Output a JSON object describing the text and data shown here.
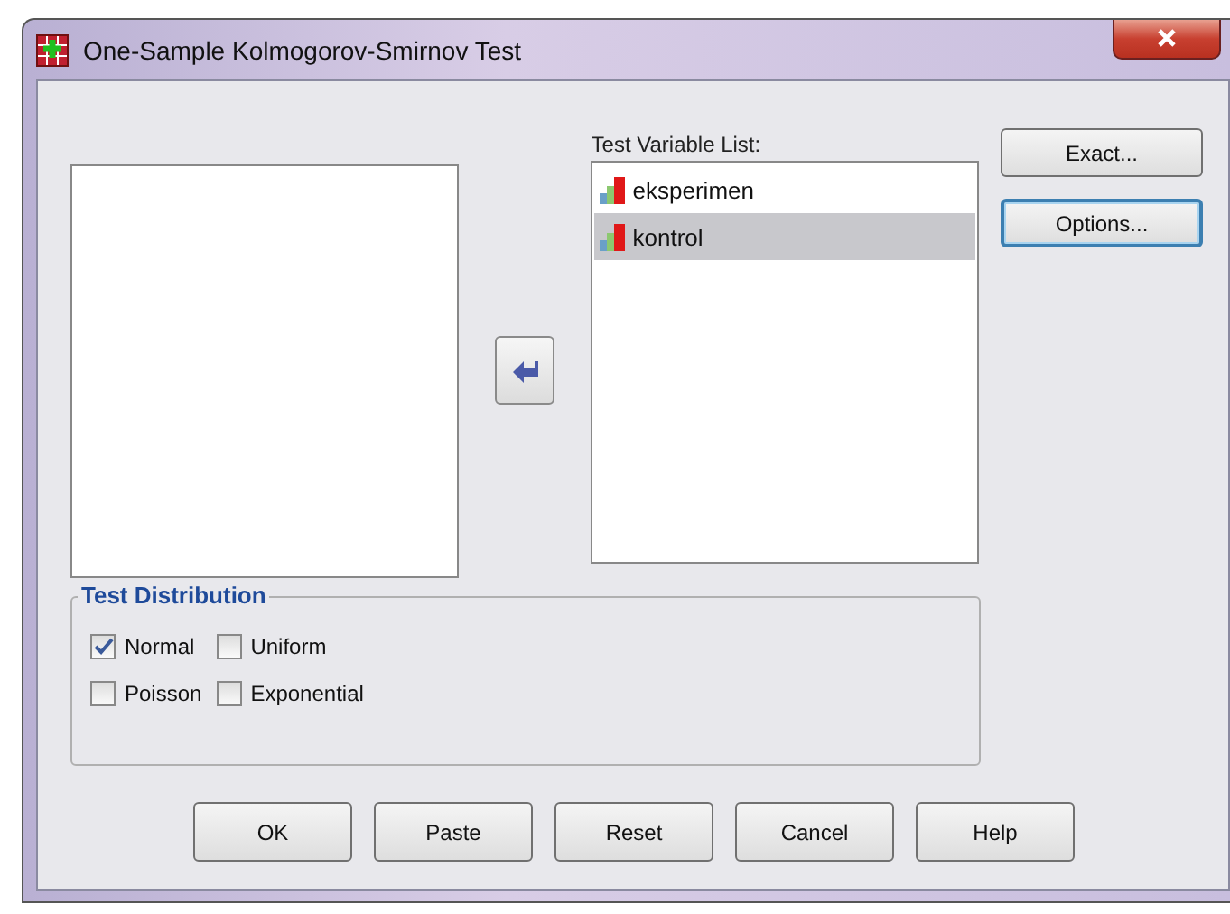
{
  "window": {
    "title": "One-Sample Kolmogorov-Smirnov Test"
  },
  "test_variable_list": {
    "label": "Test Variable List:",
    "items": [
      {
        "name": "eksperimen",
        "selected": false
      },
      {
        "name": "kontrol",
        "selected": true
      }
    ]
  },
  "side_buttons": [
    {
      "label": "Exact...",
      "focused": false
    },
    {
      "label": "Options...",
      "focused": true
    }
  ],
  "test_distribution": {
    "title": "Test Distribution",
    "options": [
      {
        "label": "Normal",
        "checked": true
      },
      {
        "label": "Uniform",
        "checked": false
      },
      {
        "label": "Poisson",
        "checked": false
      },
      {
        "label": "Exponential",
        "checked": false
      }
    ]
  },
  "buttons": [
    "OK",
    "Paste",
    "Reset",
    "Cancel",
    "Help"
  ]
}
